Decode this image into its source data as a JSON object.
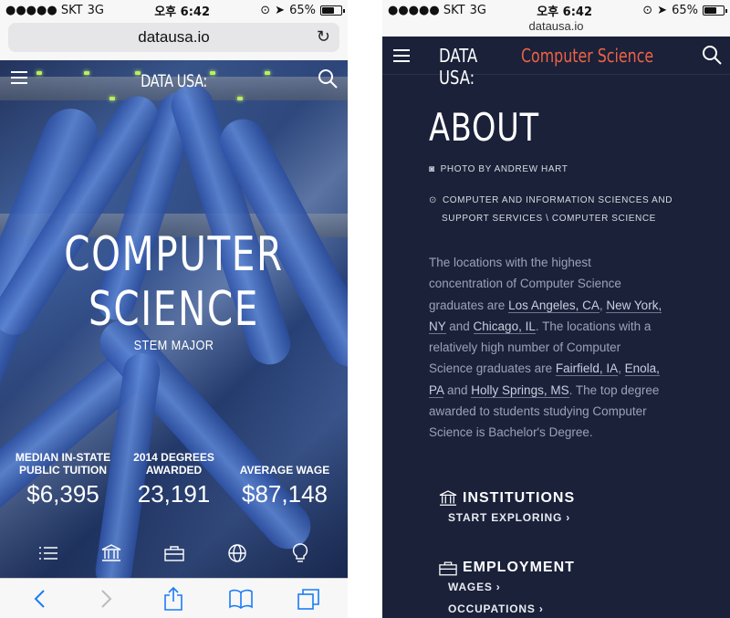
{
  "status": {
    "carrier": "●●●●● SKT",
    "network": "3G",
    "time": "오후 6:42",
    "battery": "65%",
    "battery_level": 0.65
  },
  "left": {
    "url": "datausa.io",
    "logo": "DATA USA:",
    "title_line1": "COMPUTER",
    "title_line2": "SCIENCE",
    "subtitle": "STEM MAJOR",
    "stats": [
      {
        "label": "MEDIAN IN-STATE PUBLIC TUITION",
        "value": "$6,395"
      },
      {
        "label": "2014 DEGREES AWARDED",
        "value": "23,191"
      },
      {
        "label": "AVERAGE WAGE",
        "value": "$87,148"
      }
    ],
    "icons": [
      "list-icon",
      "institution-icon",
      "briefcase-icon",
      "globe-icon",
      "lightbulb-icon"
    ],
    "toolbar": [
      "back-icon",
      "forward-icon",
      "share-icon",
      "bookmarks-icon",
      "tabs-icon"
    ]
  },
  "right": {
    "url": "datausa.io",
    "brand": "DATA USA:",
    "topic": "Computer Science",
    "about_title": "ABOUT",
    "photo_credit": "PHOTO BY ANDREW HART",
    "path_line1": "COMPUTER AND INFORMATION SCIENCES AND",
    "path_line2": "SUPPORT SERVICES \\ COMPUTER SCIENCE",
    "about": {
      "t1": "The locations with the highest concentration of Computer Science graduates are ",
      "l1": "Los Angeles, CA",
      "t2": ", ",
      "l2": "New York, NY",
      "t3": " and ",
      "l3": "Chicago, IL",
      "t4": ". The locations with a relatively high number of Computer Science graduates are ",
      "l4": "Fairfield, IA",
      "t5": ", ",
      "l5": "Enola, PA",
      "t6": " and ",
      "l6": "Holly Springs, MS",
      "t7": ". The top degree awarded to students studying Computer Science is Bachelor's Degree."
    },
    "sections": [
      {
        "title": "INSTITUTIONS",
        "links": [
          "START EXPLORING ›"
        ]
      },
      {
        "title": "EMPLOYMENT",
        "links": [
          "WAGES ›",
          "OCCUPATIONS ›"
        ]
      }
    ]
  }
}
